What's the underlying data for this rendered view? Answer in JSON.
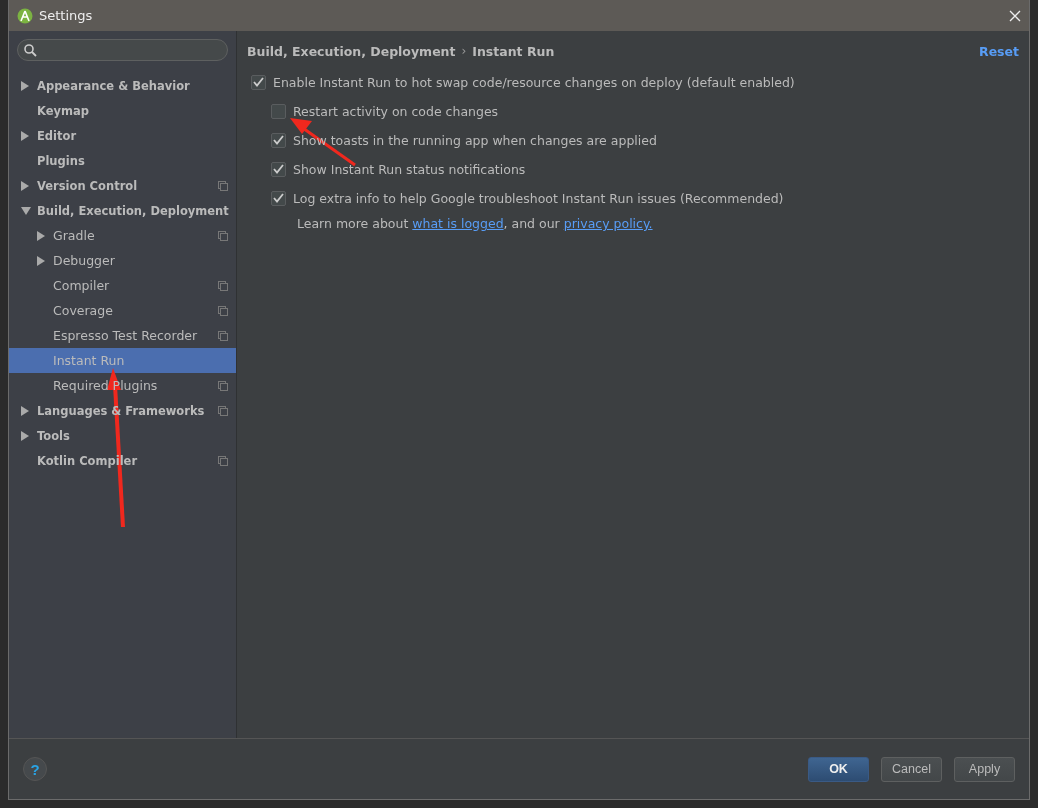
{
  "window": {
    "title": "Settings"
  },
  "tree": [
    {
      "label": "Appearance & Behavior",
      "expandable": true,
      "expanded": false,
      "selected": false,
      "project": false
    },
    {
      "label": "Keymap",
      "expandable": false,
      "selected": false,
      "project": false
    },
    {
      "label": "Editor",
      "expandable": true,
      "expanded": false,
      "selected": false,
      "project": false
    },
    {
      "label": "Plugins",
      "expandable": false,
      "selected": false,
      "project": false
    },
    {
      "label": "Version Control",
      "expandable": true,
      "expanded": false,
      "selected": false,
      "project": true
    },
    {
      "label": "Build, Execution, Deployment",
      "expandable": true,
      "expanded": true,
      "selected": false,
      "project": false,
      "children": [
        {
          "label": "Gradle",
          "expandable": true,
          "expanded": false,
          "selected": false,
          "project": true
        },
        {
          "label": "Debugger",
          "expandable": true,
          "expanded": false,
          "selected": false,
          "project": false
        },
        {
          "label": "Compiler",
          "expandable": false,
          "selected": false,
          "project": true
        },
        {
          "label": "Coverage",
          "expandable": false,
          "selected": false,
          "project": true
        },
        {
          "label": "Espresso Test Recorder",
          "expandable": false,
          "selected": false,
          "project": true
        },
        {
          "label": "Instant Run",
          "expandable": false,
          "selected": true,
          "project": false
        },
        {
          "label": "Required Plugins",
          "expandable": false,
          "selected": false,
          "project": true
        }
      ]
    },
    {
      "label": "Languages & Frameworks",
      "expandable": true,
      "expanded": false,
      "selected": false,
      "project": true
    },
    {
      "label": "Tools",
      "expandable": true,
      "expanded": false,
      "selected": false,
      "project": false
    },
    {
      "label": "Kotlin Compiler",
      "expandable": false,
      "selected": false,
      "project": true
    }
  ],
  "breadcrumb": {
    "parent": "Build, Execution, Deployment",
    "separator": "›",
    "current": "Instant Run",
    "reset": "Reset"
  },
  "options": [
    {
      "label": "Enable Instant Run to hot swap code/resource changes on deploy (default enabled)",
      "checked": true,
      "children": [
        {
          "label": "Restart activity on code changes",
          "checked": false
        },
        {
          "label": "Show toasts in the running app when changes are applied",
          "checked": true
        },
        {
          "label": "Show Instant Run status notifications",
          "checked": true
        },
        {
          "label": "Log extra info to help Google troubleshoot Instant Run issues (Recommended)",
          "checked": true
        }
      ]
    }
  ],
  "learn_more": {
    "before": "Learn more about ",
    "link1": "what is logged",
    "middle": ", and our ",
    "link2": "privacy policy."
  },
  "buttons": [
    {
      "label": "OK",
      "kind": "default"
    },
    {
      "label": "Cancel",
      "kind": "normal"
    },
    {
      "label": "Apply",
      "kind": "normal"
    }
  ],
  "help": {
    "label": "?"
  }
}
